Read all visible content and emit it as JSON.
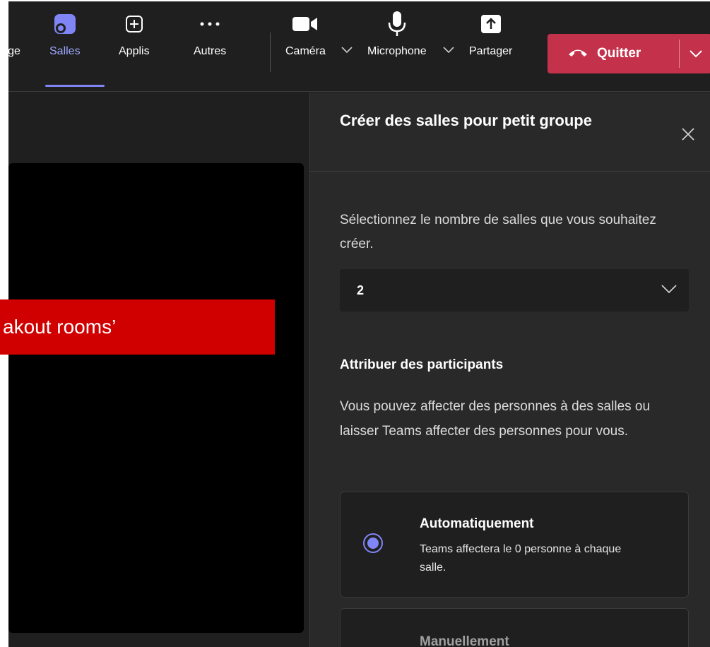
{
  "toolbar": {
    "partial_label": "ge",
    "salles_label": "Salles",
    "applis_label": "Applis",
    "autres_label": "Autres",
    "camera_label": "Caméra",
    "microphone_label": "Microphone",
    "partager_label": "Partager",
    "quitter_label": "Quitter"
  },
  "stage": {
    "banner_text": "akout rooms’"
  },
  "panel": {
    "title": "Créer des salles pour petit groupe",
    "rooms_description": "Sélectionnez le nombre de salles que vous souhaitez créer.",
    "rooms_selected_value": "2",
    "assign_heading": "Attribuer des participants",
    "assign_description": "Vous pouvez affecter des personnes à des salles ou laisser Teams affecter des personnes pour vous.",
    "options": [
      {
        "title": "Automatiquement",
        "description": "Teams affectera le 0 personne à chaque salle.",
        "selected": true
      },
      {
        "title": "Manuellement",
        "selected": false
      }
    ]
  },
  "colors": {
    "accent": "#7f85f5",
    "quit_button": "#c4314b",
    "banner": "#d10000",
    "background": "#1f1f1f",
    "panel": "#292929"
  },
  "icons": {
    "salles": "rooms-icon",
    "applis": "plus-square-icon",
    "autres": "more-dots-icon",
    "camera": "camera-icon",
    "microphone": "microphone-icon",
    "partager": "share-icon",
    "quitter": "phone-hangup-icon",
    "close": "close-icon",
    "dropdown": "chevron-down-icon"
  }
}
